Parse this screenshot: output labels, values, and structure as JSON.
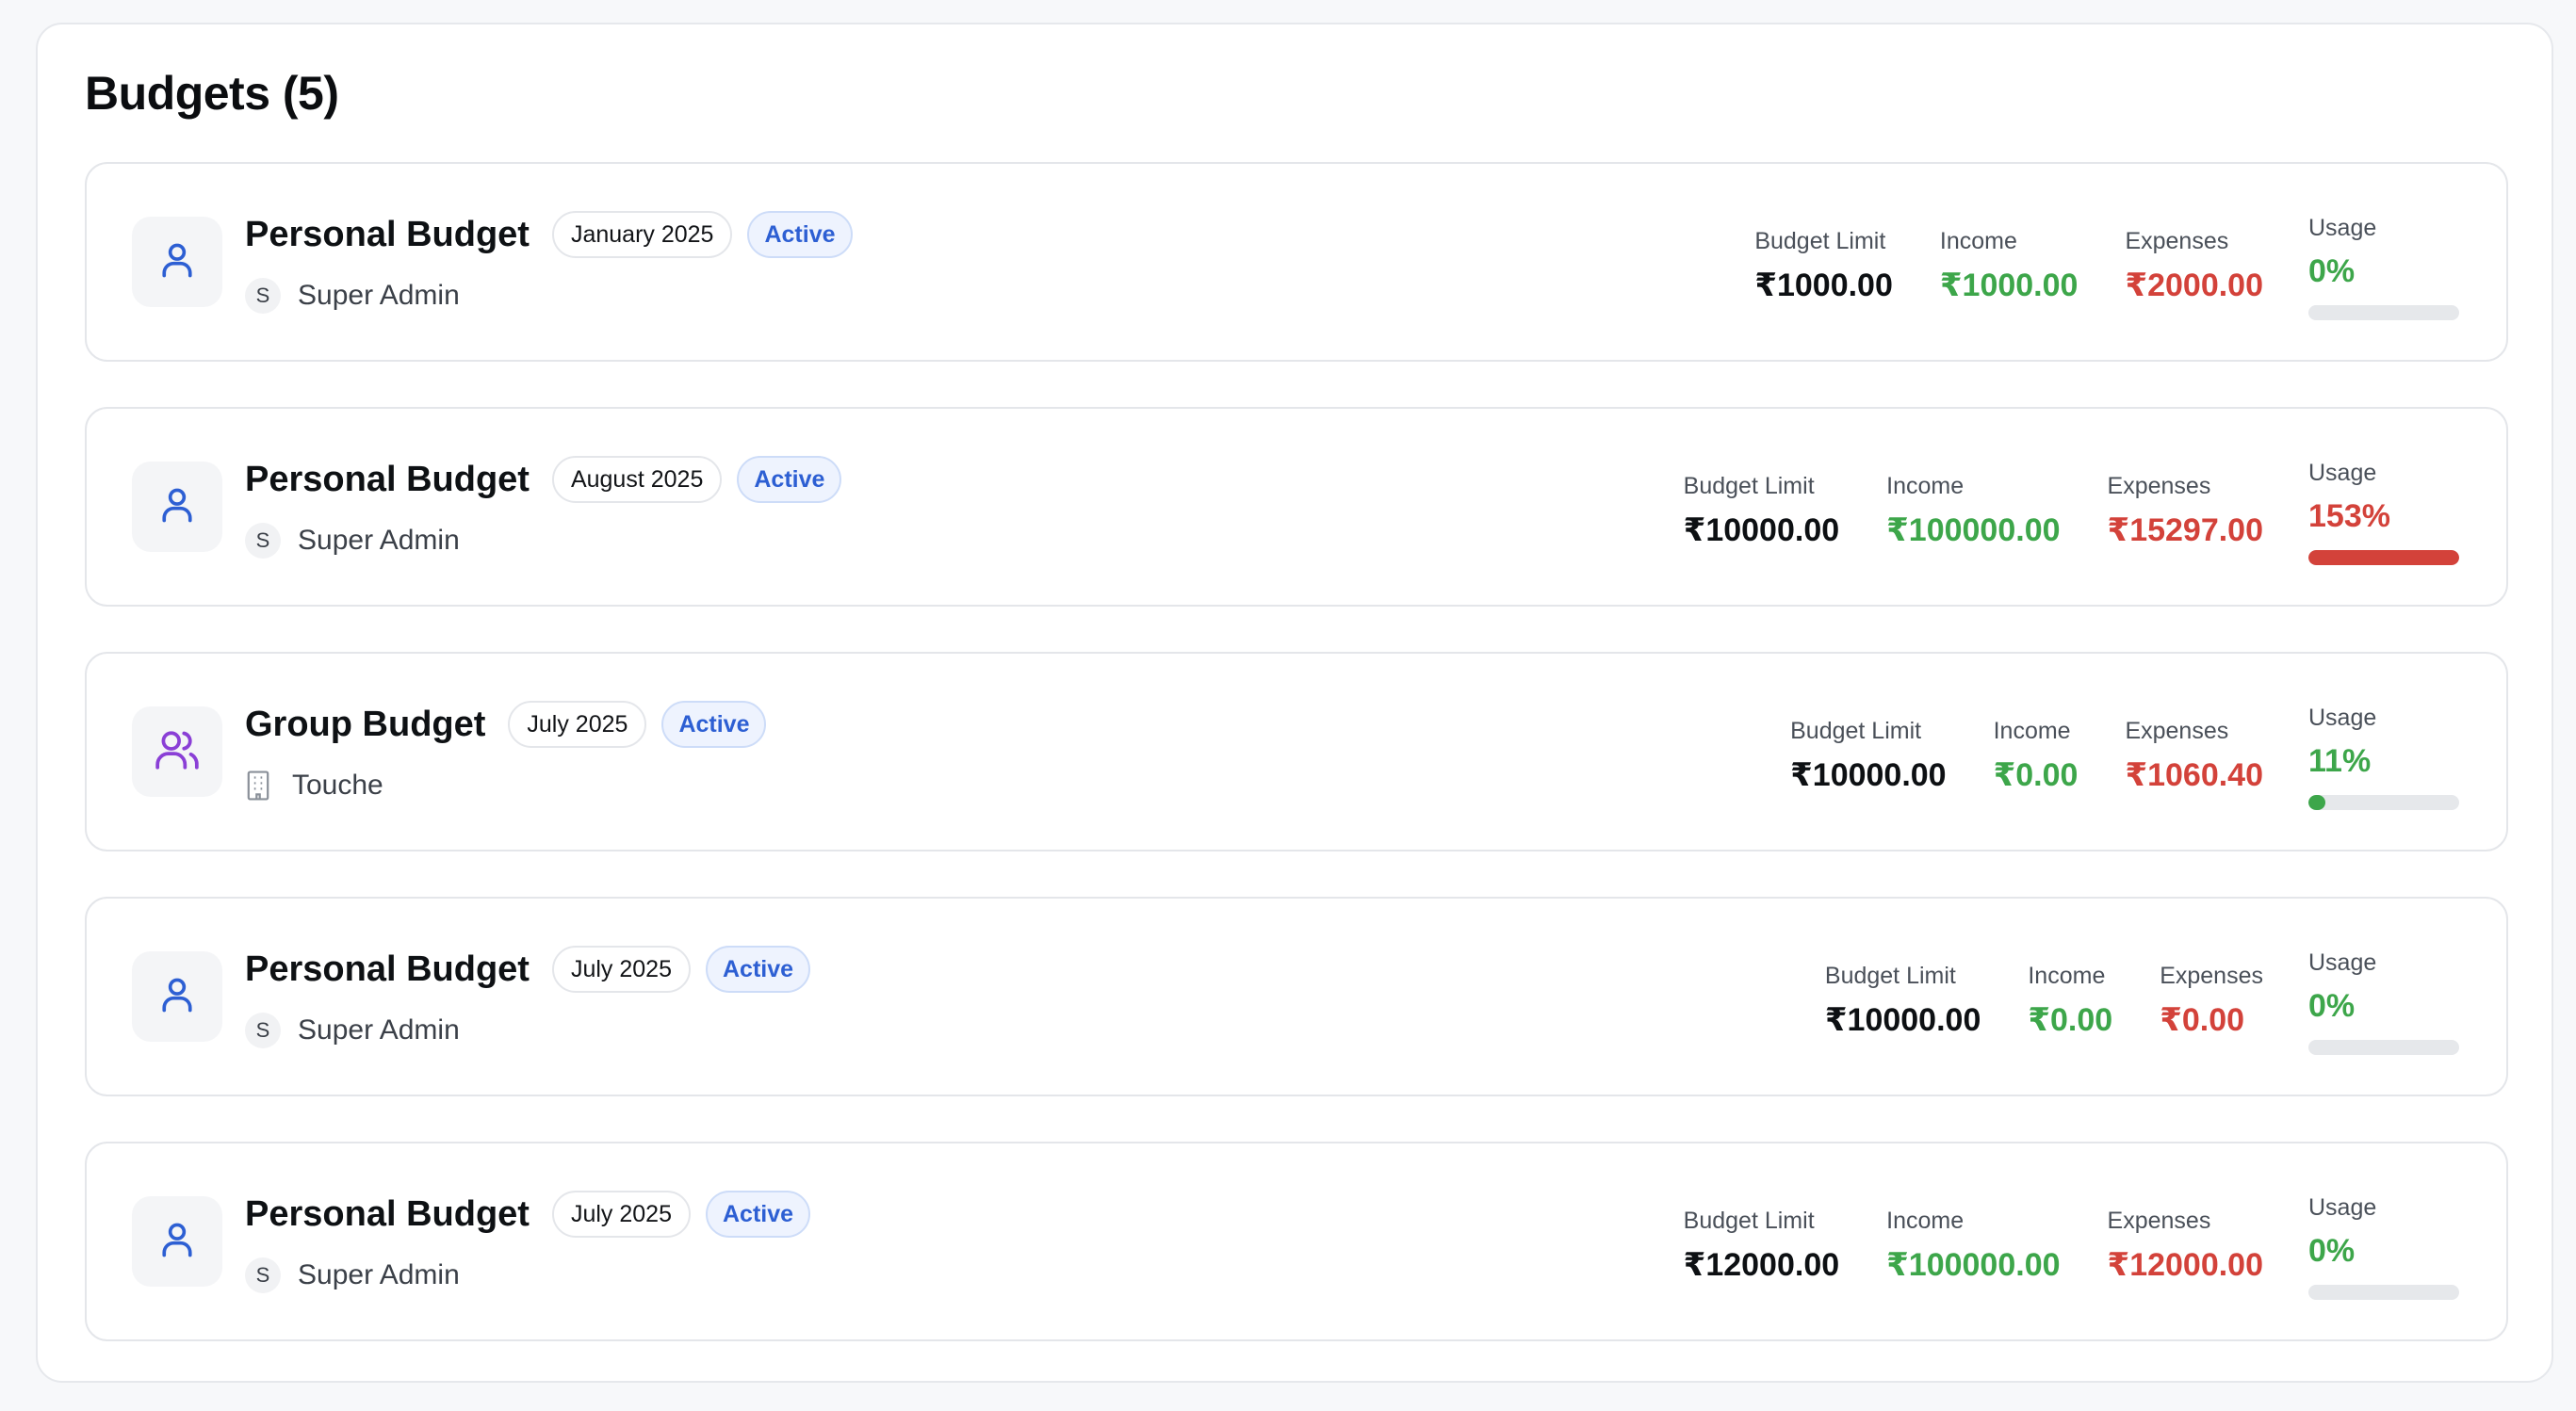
{
  "page": {
    "title": "Budgets (5)"
  },
  "colors": {
    "income": "#3da64a",
    "expense": "#d3423a",
    "over_budget": "#d3423a",
    "within_budget": "#3da64a",
    "personal_icon": "#2d5fd3",
    "group_icon": "#8a3fd6",
    "status_active": "#2d5fd3"
  },
  "labels": {
    "budget_limit": "Budget Limit",
    "income": "Income",
    "expenses": "Expenses",
    "usage": "Usage"
  },
  "budgets": [
    {
      "name": "Personal Budget",
      "type_icon": "user-icon",
      "period": "January 2025",
      "status": "Active",
      "owner_initial": "S",
      "owner_name": "Super Admin",
      "owner_icon": "initial-avatar",
      "budget_limit": "₹1000.00",
      "income": "₹1000.00",
      "expenses": "₹2000.00",
      "usage": "0%",
      "usage_fraction": 0,
      "usage_status": "within"
    },
    {
      "name": "Personal Budget",
      "type_icon": "user-icon",
      "period": "August 2025",
      "status": "Active",
      "owner_initial": "S",
      "owner_name": "Super Admin",
      "owner_icon": "initial-avatar",
      "budget_limit": "₹10000.00",
      "income": "₹100000.00",
      "expenses": "₹15297.00",
      "usage": "153%",
      "usage_fraction": 1,
      "usage_status": "over"
    },
    {
      "name": "Group Budget",
      "type_icon": "users-icon",
      "period": "July 2025",
      "status": "Active",
      "owner_initial": "",
      "owner_name": "Touche",
      "owner_icon": "building-icon",
      "budget_limit": "₹10000.00",
      "income": "₹0.00",
      "expenses": "₹1060.40",
      "usage": "11%",
      "usage_fraction": 0.11,
      "usage_status": "within"
    },
    {
      "name": "Personal Budget",
      "type_icon": "user-icon",
      "period": "July 2025",
      "status": "Active",
      "owner_initial": "S",
      "owner_name": "Super Admin",
      "owner_icon": "initial-avatar",
      "budget_limit": "₹10000.00",
      "income": "₹0.00",
      "expenses": "₹0.00",
      "usage": "0%",
      "usage_fraction": 0,
      "usage_status": "within"
    },
    {
      "name": "Personal Budget",
      "type_icon": "user-icon",
      "period": "July 2025",
      "status": "Active",
      "owner_initial": "S",
      "owner_name": "Super Admin",
      "owner_icon": "initial-avatar",
      "budget_limit": "₹12000.00",
      "income": "₹100000.00",
      "expenses": "₹12000.00",
      "usage": "0%",
      "usage_fraction": 0,
      "usage_status": "within"
    }
  ]
}
